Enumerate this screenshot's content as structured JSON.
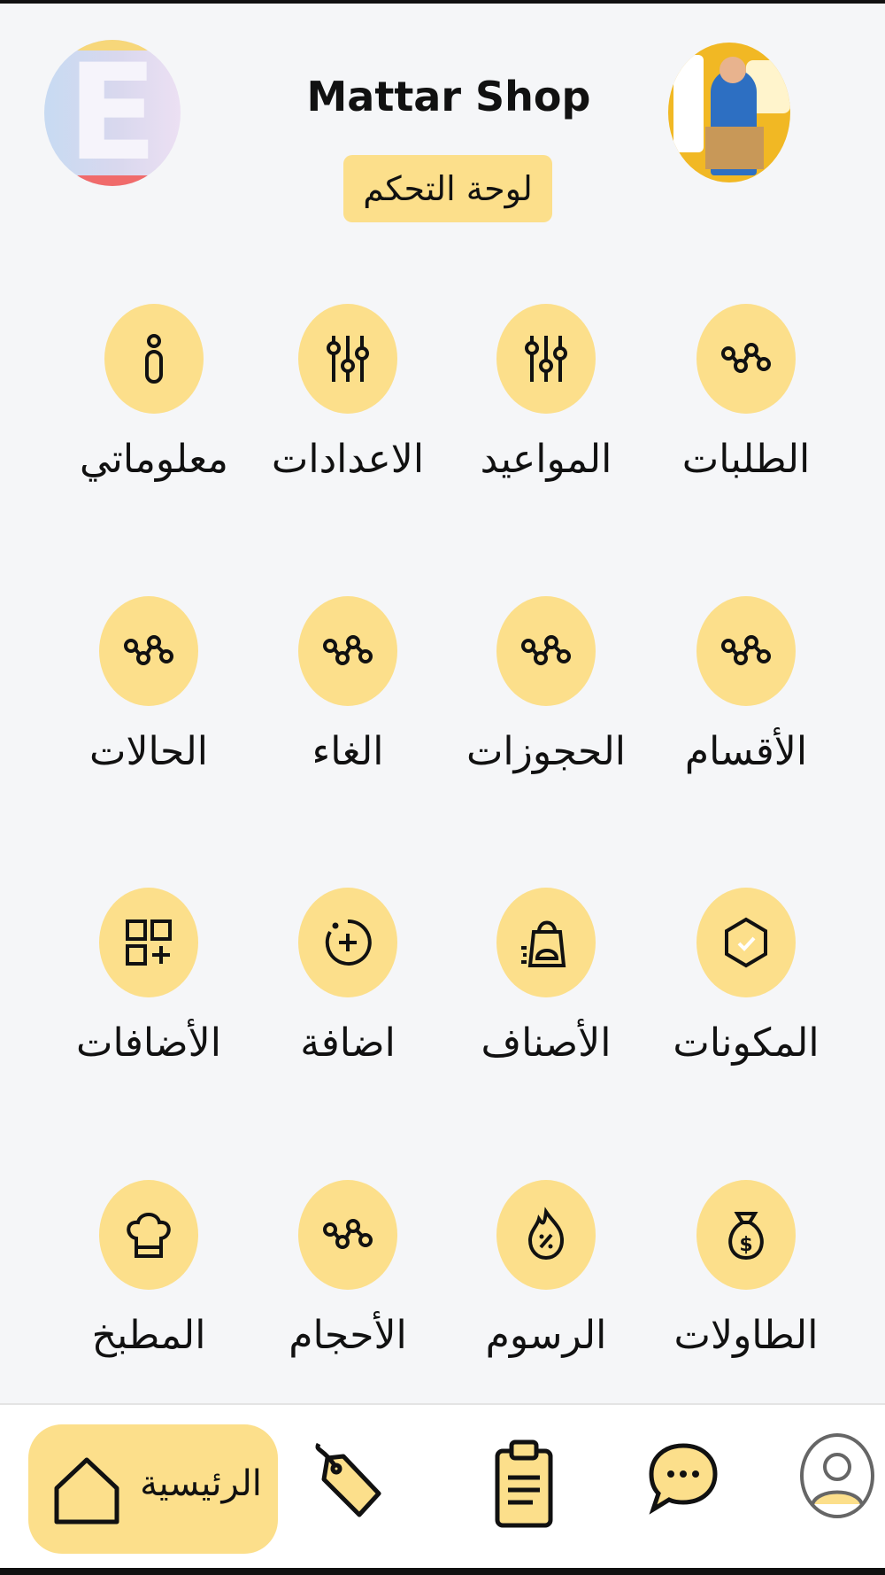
{
  "header": {
    "title": "Mattar Shop",
    "subtitle": "لوحة التحكم",
    "left_avatar_letter": "E"
  },
  "grid": [
    {
      "label": "الطلبات",
      "icon": "nodes-icon"
    },
    {
      "label": "المواعيد",
      "icon": "sliders-icon"
    },
    {
      "label": "الاعدادات",
      "icon": "sliders-icon"
    },
    {
      "label": "معلوماتي",
      "icon": "info-icon"
    },
    {
      "label": "الأقسام",
      "icon": "nodes-icon"
    },
    {
      "label": "الحجوزات",
      "icon": "nodes-icon"
    },
    {
      "label": "الغاء",
      "icon": "nodes-icon"
    },
    {
      "label": "الحالات",
      "icon": "nodes-icon"
    },
    {
      "label": "المكونات",
      "icon": "hexagon-check-icon"
    },
    {
      "label": "الأصناف",
      "icon": "shopping-bag-icon"
    },
    {
      "label": "اضافة",
      "icon": "add-circle-icon"
    },
    {
      "label": "الأضافات",
      "icon": "grid-add-icon"
    },
    {
      "label": "الطاولات",
      "icon": "money-bag-icon"
    },
    {
      "label": "الرسوم",
      "icon": "flame-percent-icon"
    },
    {
      "label": "الأحجام",
      "icon": "nodes-icon"
    },
    {
      "label": "المطبخ",
      "icon": "chef-hat-icon"
    }
  ],
  "bottom_nav": {
    "home_label": "الرئيسية",
    "items": [
      "home-icon",
      "tag-icon",
      "clipboard-icon",
      "chat-icon",
      "profile-icon"
    ]
  },
  "colors": {
    "accent": "#fcdf8b",
    "background": "#f5f6f8",
    "text": "#111111"
  }
}
